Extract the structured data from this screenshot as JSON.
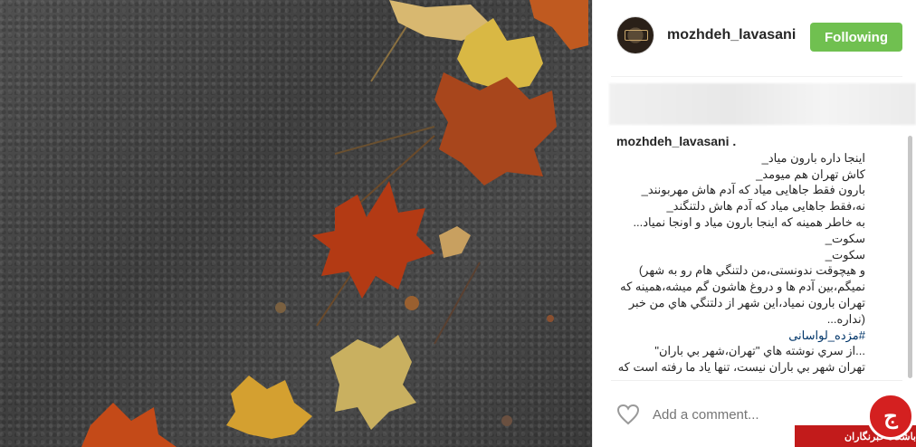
{
  "post": {
    "username": "mozhdeh_lavasani",
    "follow_label": "Following",
    "caption_user": "mozhdeh_lavasani .",
    "caption_lines": [
      "اینجا داره بارون میاد_",
      "کاش تهران هم میومد_",
      "بارون فقط جاهایی میاد که آدم هاش مهربونند_",
      "نه،فقط جاهایی میاد که آدم هاش دلتنگند_",
      "به خاطر همینه که اینجا بارون میاد و اونجا نمیاد...",
      "سکوت_",
      "سکوت_",
      "و هیچوقت ندونستی،من دلتنگي هام رو به شهر)",
      "نمیگم،بین آدم ها و دروغ هاشون گم میشه،همینه که",
      "تهران بارون نمیاد،این شهر از دلتنگي هاي من خبر",
      "(نداره...",
      "#مژده_لواسانی",
      "...از سري نوشته هاي \"تهران،شهر بي باران\"",
      "تهران شهر بي باران نيست، تنها ياد ما رفته است كه"
    ],
    "comment_placeholder": "Add a comment..."
  },
  "watermark": {
    "label": "باشگاه خبرنگاران",
    "logo_glyph": "ج"
  },
  "colors": {
    "follow_green": "#70c050",
    "hashtag_blue": "#003569",
    "watermark_red": "#c21b1b"
  }
}
